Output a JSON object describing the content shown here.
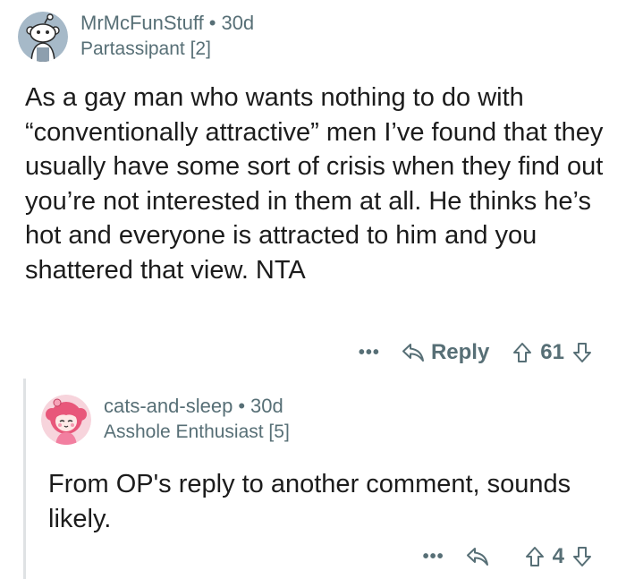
{
  "comment": {
    "username": "MrMcFunStuff",
    "separator": "•",
    "age": "30d",
    "flair": "Partassipant [2]",
    "body": "As a gay man who wants nothing to do with “conventionally attractive” men I’ve found that they usually have some sort of crisis when they find out you’re not interested in them at all. He thinks he’s hot and everyone is attracted to him and you shattered that view. NTA",
    "more_label": "•••",
    "reply_label": "Reply",
    "vote_count": "61",
    "icons": [
      "avatar-snoo-icon",
      "more-icon",
      "reply-arrow-icon",
      "upvote-icon",
      "downvote-icon"
    ]
  },
  "reply": {
    "username": "cats-and-sleep",
    "separator": "•",
    "age": "30d",
    "flair": "Asshole Enthusiast [5]",
    "body": "From OP's reply to another comment, sounds likely.",
    "more_label": "•••",
    "vote_count": "4",
    "icons": [
      "avatar-anime-girl-icon",
      "more-icon",
      "reply-arrow-icon",
      "upvote-icon",
      "downvote-icon"
    ]
  },
  "colors": {
    "meta_gray": "#576f76",
    "text": "#1c1c1c",
    "thread_line": "#dfe2e4",
    "avatar_bg": "#a6b9c8",
    "avatar2_bg": "#f7d4dc"
  }
}
